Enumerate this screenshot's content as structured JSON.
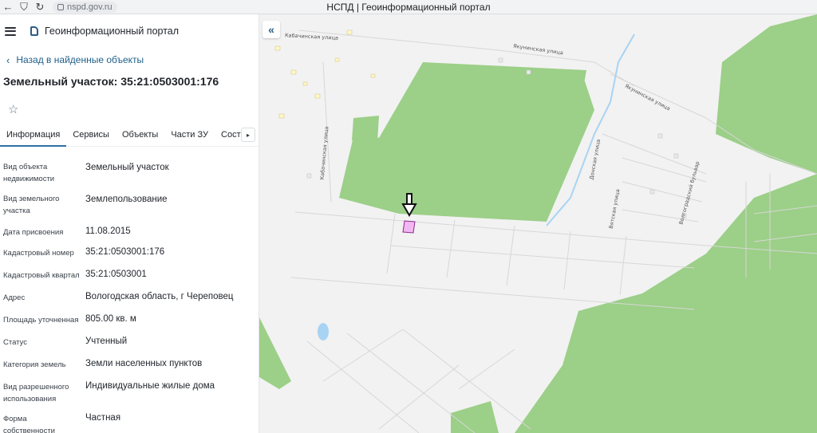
{
  "browser": {
    "back": "←",
    "shield": "⛉",
    "reload": "↻",
    "url": "nspd.gov.ru",
    "title": "НСПД | Геоинформационный портал"
  },
  "header": {
    "portal_title": "Геоинформационный портал"
  },
  "back_link": "Назад в найденные объекты",
  "page_title": "Земельный участок: 35:21:0503001:176",
  "favorite_icon": "☆",
  "tabs": [
    "Информация",
    "Сервисы",
    "Объекты",
    "Части ЗУ",
    "Состав"
  ],
  "tab_scroll_icon": "▸",
  "properties": [
    {
      "label": "Вид объекта недвижимости",
      "value": "Земельный участок"
    },
    {
      "label": "Вид земельного участка",
      "value": "Землепользование"
    },
    {
      "label": "Дата присвоения",
      "value": "11.08.2015"
    },
    {
      "label": "Кадастровый номер",
      "value": "35:21:0503001:176"
    },
    {
      "label": "Кадастровый квартал",
      "value": "35:21:0503001"
    },
    {
      "label": "Адрес",
      "value": "Вологодская область, г Череповец"
    },
    {
      "label": "Площадь уточненная",
      "value": "805.00 кв. м"
    },
    {
      "label": "Статус",
      "value": "Учтенный"
    },
    {
      "label": "Категория земель",
      "value": "Земли населенных пунктов"
    },
    {
      "label": "Вид разрешенного использования",
      "value": "Индивидуальные жилые дома"
    },
    {
      "label": "Форма собственности",
      "value": "Частная"
    }
  ],
  "map": {
    "collapse_icon": "«",
    "streets": {
      "kabachinskaya": "Кабачинская улица",
      "yakunina_top": "Якунинская улица",
      "yakunina_right": "Якунинская улица",
      "kabachinskaya_v": "Кабачинская улица",
      "donskaya": "Донская улица",
      "vyatskaya": "Вятская улица",
      "volgograd": "Волгоградский бульвар"
    },
    "colors": {
      "forest": "#9ccf88",
      "background": "#f2f2f2",
      "parcel": "#f2b6f2",
      "water": "#a9d3f2"
    }
  }
}
